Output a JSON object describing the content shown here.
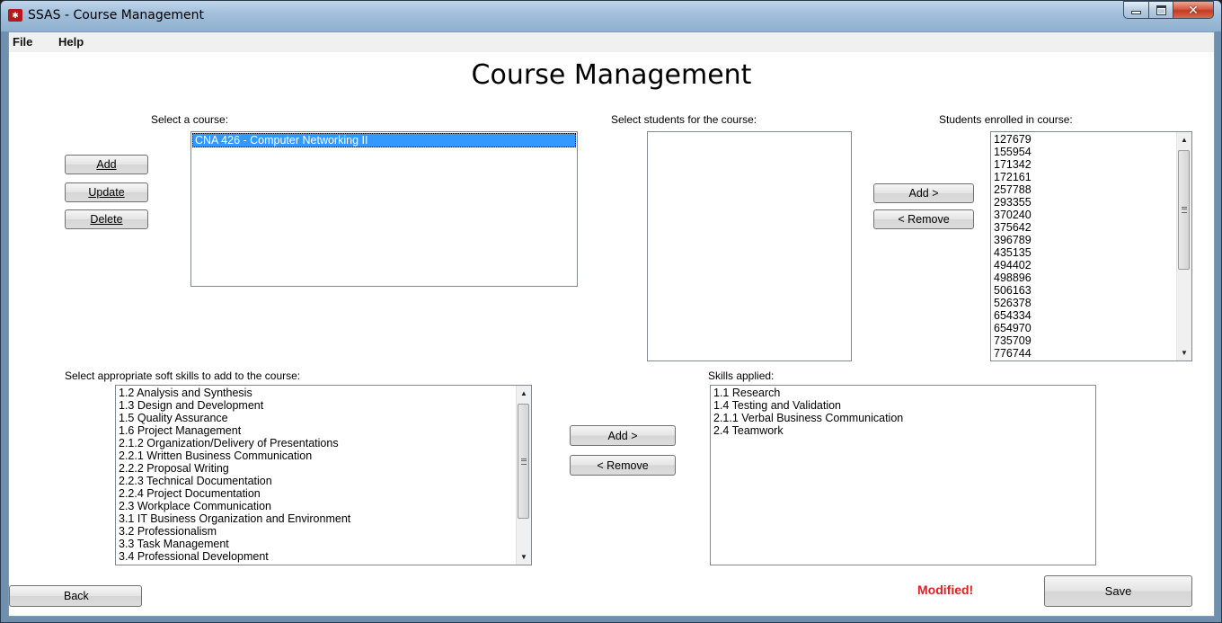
{
  "window": {
    "title": "SSAS - Course Management",
    "app_icon": "ssas-logo-icon",
    "caption_buttons": {
      "minimize": "minimize-icon",
      "maximize": "maximize-icon",
      "close": "close-icon"
    }
  },
  "menu": {
    "file": "File",
    "help": "Help"
  },
  "page": {
    "title": "Course Management"
  },
  "course": {
    "label": "Select a course:",
    "items": [
      "CNA 426 - Computer Networking II"
    ],
    "selected_index": 0,
    "buttons": {
      "add": "Add",
      "update": "Update",
      "delete": "Delete"
    }
  },
  "students_available": {
    "label": "Select students for the course:",
    "items": []
  },
  "student_transfer": {
    "add": "Add >",
    "remove": "< Remove"
  },
  "students_enrolled": {
    "label": "Students enrolled in course:",
    "items": [
      "127679",
      "155954",
      "171342",
      "172161",
      "257788",
      "293355",
      "370240",
      "375642",
      "396789",
      "435135",
      "494402",
      "498896",
      "506163",
      "526378",
      "654334",
      "654970",
      "735709",
      "776744"
    ]
  },
  "soft_skills": {
    "label": "Select appropriate soft skills to add to the course:",
    "items": [
      "1.2 Analysis and Synthesis",
      "1.3 Design and Development",
      "1.5 Quality Assurance",
      "1.6 Project Management",
      "2.1.2 Organization/Delivery of Presentations",
      "2.2.1 Written Business Communication",
      "2.2.2 Proposal Writing",
      "2.2.3 Technical Documentation",
      "2.2.4 Project Documentation",
      "2.3 Workplace Communication",
      "3.1 IT Business Organization and Environment",
      "3.2 Professionalism",
      "3.3 Task Management",
      "3.4 Professional Development"
    ]
  },
  "skill_transfer": {
    "add": "Add >",
    "remove": "< Remove"
  },
  "skills_applied": {
    "label": "Skills applied:",
    "items": [
      "1.1 Research",
      "1.4 Testing and Validation",
      "2.1.1 Verbal Business Communication",
      "2.4 Teamwork"
    ]
  },
  "footer": {
    "back": "Back",
    "status": "Modified!",
    "save": "Save"
  },
  "colors": {
    "selection": "#3399ff",
    "status": "#e02020",
    "frame": "#6f8fae"
  }
}
